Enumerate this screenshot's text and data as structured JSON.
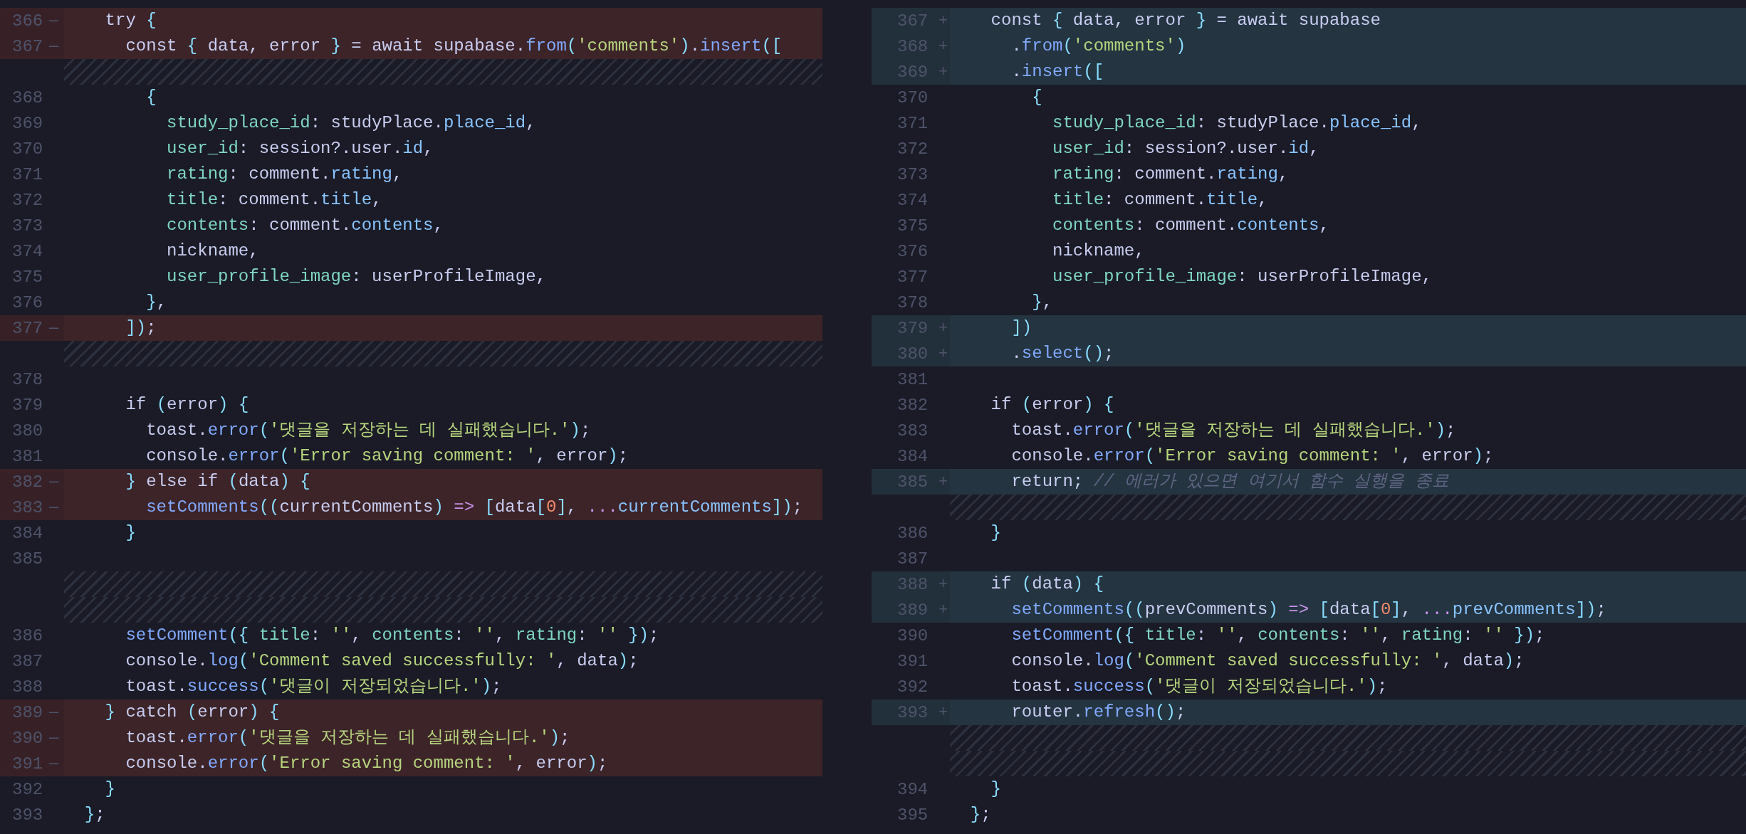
{
  "left_pane": {
    "rows": [
      {
        "kind": "removed",
        "num": "366",
        "marker": "—",
        "code": "    try {"
      },
      {
        "kind": "removed",
        "num": "367",
        "marker": "—",
        "code": "      const { data, error } = await supabase.from('comments').insert(["
      },
      {
        "kind": "filler"
      },
      {
        "kind": "plain",
        "num": "368",
        "code": "        {"
      },
      {
        "kind": "plain",
        "num": "369",
        "code": "          study_place_id: studyPlace.place_id,"
      },
      {
        "kind": "plain",
        "num": "370",
        "code": "          user_id: session?.user.id,"
      },
      {
        "kind": "plain",
        "num": "371",
        "code": "          rating: comment.rating,"
      },
      {
        "kind": "plain",
        "num": "372",
        "code": "          title: comment.title,"
      },
      {
        "kind": "plain",
        "num": "373",
        "code": "          contents: comment.contents,"
      },
      {
        "kind": "plain",
        "num": "374",
        "code": "          nickname,"
      },
      {
        "kind": "plain",
        "num": "375",
        "code": "          user_profile_image: userProfileImage,"
      },
      {
        "kind": "plain",
        "num": "376",
        "code": "        },"
      },
      {
        "kind": "removed",
        "num": "377",
        "marker": "—",
        "code": "      ]);"
      },
      {
        "kind": "filler"
      },
      {
        "kind": "plain",
        "num": "378"
      },
      {
        "kind": "plain",
        "num": "379",
        "code": "      if (error) {"
      },
      {
        "kind": "plain",
        "num": "380",
        "code": "        toast.error('댓글을 저장하는 데 실패했습니다.');"
      },
      {
        "kind": "plain",
        "num": "381",
        "code": "        console.error('Error saving comment: ', error);"
      },
      {
        "kind": "removed",
        "num": "382",
        "marker": "—",
        "code": "      } else if (data) {"
      },
      {
        "kind": "removed",
        "num": "383",
        "marker": "—",
        "code": "        setComments((currentComments) => [data[0], ...currentComments]);"
      },
      {
        "kind": "plain",
        "num": "384",
        "code": "      }"
      },
      {
        "kind": "plain",
        "num": "385"
      },
      {
        "kind": "filler"
      },
      {
        "kind": "filler"
      },
      {
        "kind": "plain",
        "num": "386",
        "code": "      setComment({ title: '', contents: '', rating: '' });"
      },
      {
        "kind": "plain",
        "num": "387",
        "code": "      console.log('Comment saved successfully: ', data);"
      },
      {
        "kind": "plain",
        "num": "388",
        "code": "      toast.success('댓글이 저장되었습니다.');"
      },
      {
        "kind": "removed",
        "num": "389",
        "marker": "—",
        "code": "    } catch (error) {"
      },
      {
        "kind": "removed",
        "num": "390",
        "marker": "—",
        "code": "      toast.error('댓글을 저장하는 데 실패했습니다.');"
      },
      {
        "kind": "removed",
        "num": "391",
        "marker": "—",
        "code": "      console.error('Error saving comment: ', error);"
      },
      {
        "kind": "plain",
        "num": "392",
        "code": "    }"
      },
      {
        "kind": "plain",
        "num": "393",
        "code": "  };"
      }
    ]
  },
  "right_pane": {
    "rows": [
      {
        "kind": "added",
        "num": "367",
        "marker": "+",
        "code": "    const { data, error } = await supabase"
      },
      {
        "kind": "added",
        "num": "368",
        "marker": "+",
        "code": "      .from('comments')"
      },
      {
        "kind": "added",
        "num": "369",
        "marker": "+",
        "code": "      .insert(["
      },
      {
        "kind": "plain",
        "num": "370",
        "code": "        {"
      },
      {
        "kind": "plain",
        "num": "371",
        "code": "          study_place_id: studyPlace.place_id,"
      },
      {
        "kind": "plain",
        "num": "372",
        "code": "          user_id: session?.user.id,"
      },
      {
        "kind": "plain",
        "num": "373",
        "code": "          rating: comment.rating,"
      },
      {
        "kind": "plain",
        "num": "374",
        "code": "          title: comment.title,"
      },
      {
        "kind": "plain",
        "num": "375",
        "code": "          contents: comment.contents,"
      },
      {
        "kind": "plain",
        "num": "376",
        "code": "          nickname,"
      },
      {
        "kind": "plain",
        "num": "377",
        "code": "          user_profile_image: userProfileImage,"
      },
      {
        "kind": "plain",
        "num": "378",
        "code": "        },"
      },
      {
        "kind": "added",
        "num": "379",
        "marker": "+",
        "code": "      ])"
      },
      {
        "kind": "added",
        "num": "380",
        "marker": "+",
        "code": "      .select();"
      },
      {
        "kind": "plain",
        "num": "381"
      },
      {
        "kind": "plain",
        "num": "382",
        "code": "    if (error) {"
      },
      {
        "kind": "plain",
        "num": "383",
        "code": "      toast.error('댓글을 저장하는 데 실패했습니다.');"
      },
      {
        "kind": "plain",
        "num": "384",
        "code": "      console.error('Error saving comment: ', error);"
      },
      {
        "kind": "added",
        "num": "385",
        "marker": "+",
        "code": "      return; // 에러가 있으면 여기서 함수 실행을 종료"
      },
      {
        "kind": "filler"
      },
      {
        "kind": "plain",
        "num": "386",
        "code": "    }"
      },
      {
        "kind": "plain",
        "num": "387"
      },
      {
        "kind": "added",
        "num": "388",
        "marker": "+",
        "code": "    if (data) {"
      },
      {
        "kind": "added",
        "num": "389",
        "marker": "+",
        "code": "      setComments((prevComments) => [data[0], ...prevComments]);"
      },
      {
        "kind": "plain",
        "num": "390",
        "code": "      setComment({ title: '', contents: '', rating: '' });"
      },
      {
        "kind": "plain",
        "num": "391",
        "code": "      console.log('Comment saved successfully: ', data);"
      },
      {
        "kind": "plain",
        "num": "392",
        "code": "      toast.success('댓글이 저장되었습니다.');"
      },
      {
        "kind": "added",
        "num": "393",
        "marker": "+",
        "code": "      router.refresh();"
      },
      {
        "kind": "filler"
      },
      {
        "kind": "filler"
      },
      {
        "kind": "plain",
        "num": "394",
        "code": "    }"
      },
      {
        "kind": "plain",
        "num": "395",
        "code": "  };"
      }
    ]
  }
}
